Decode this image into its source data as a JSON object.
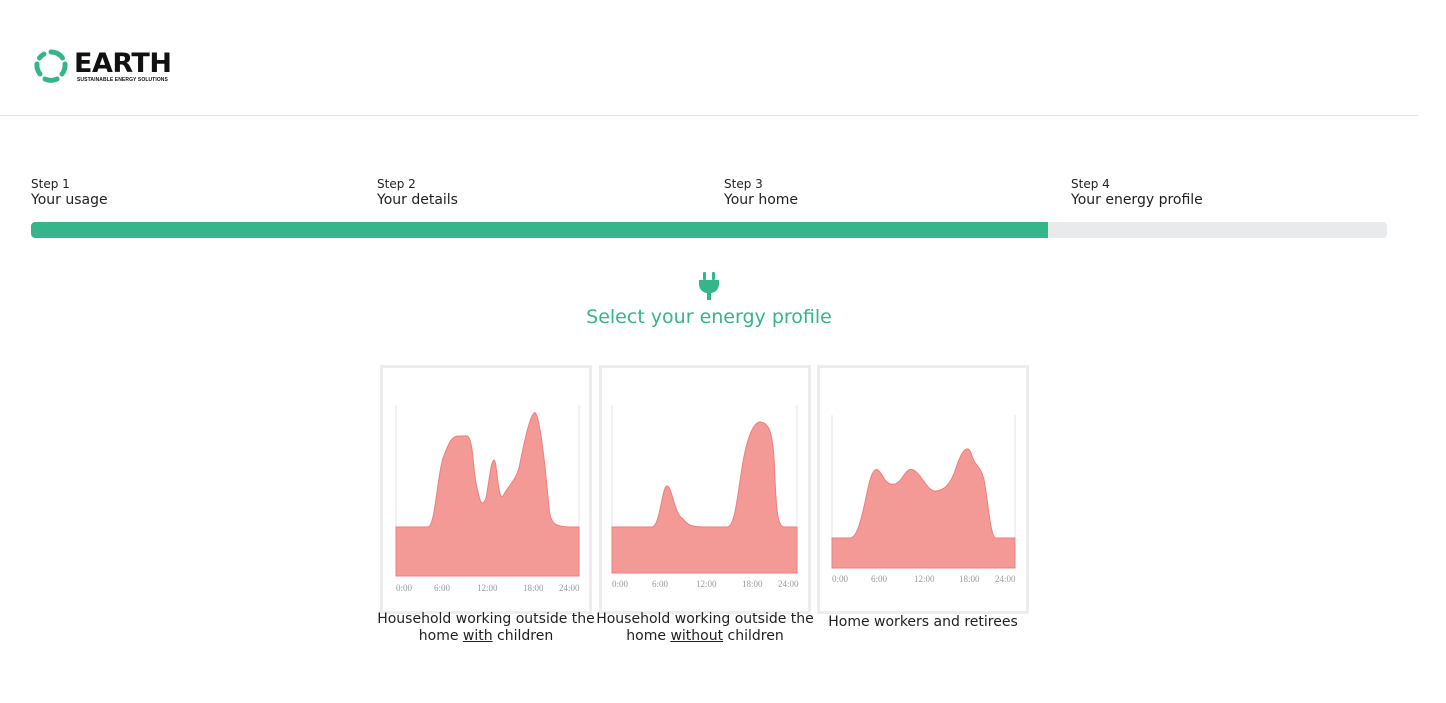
{
  "brand": {
    "name": "EARTH",
    "tagline": "SUSTAINABLE ENERGY SOLUTIONS",
    "color": "#35b58a"
  },
  "steps": [
    {
      "num": "Step 1",
      "name": "Your usage"
    },
    {
      "num": "Step 2",
      "name": "Your details"
    },
    {
      "num": "Step 3",
      "name": "Your home"
    },
    {
      "num": "Step 4",
      "name": "Your energy profile"
    }
  ],
  "progress": {
    "fraction": 0.75,
    "fill_color": "#35b58a",
    "track_color": "#e9eaec"
  },
  "page": {
    "icon": "plug-icon",
    "title": "Select your energy profile"
  },
  "profiles": [
    {
      "label_pre": "Household working outside the home ",
      "label_u": "with",
      "label_post": " children",
      "x_ticks": [
        "0:00",
        "6:00",
        "12:00",
        "18:00",
        "24:00"
      ]
    },
    {
      "label_pre": "Household working outside the home ",
      "label_u": "without",
      "label_post": " children",
      "x_ticks": [
        "0:00",
        "6:00",
        "12:00",
        "18:00",
        "24:00"
      ]
    },
    {
      "label_pre": "Home workers and retirees",
      "label_u": "",
      "label_post": "",
      "x_ticks": [
        "0:00",
        "6:00",
        "12:00",
        "18:00",
        "24:00"
      ]
    }
  ],
  "chart_colors": {
    "fill": "#f49a96",
    "stroke": "#ec7e7c",
    "tick_text": "#9a9a9a"
  }
}
